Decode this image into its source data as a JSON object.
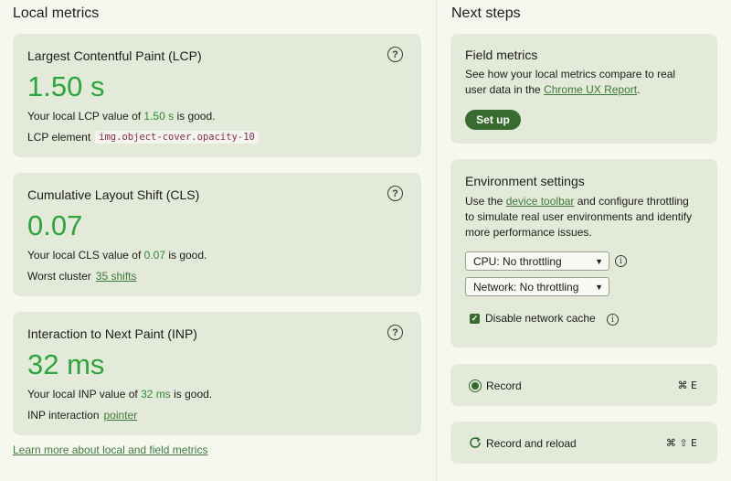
{
  "local_metrics": {
    "title": "Local metrics",
    "lcp": {
      "title": "Largest Contentful Paint (LCP)",
      "value": "1.50 s",
      "desc_prefix": "Your local LCP value of ",
      "desc_value": "1.50 s",
      "desc_suffix": " is good.",
      "detail_label": "LCP element",
      "detail_code": "img.object-cover.opacity-10"
    },
    "cls": {
      "title": "Cumulative Layout Shift (CLS)",
      "value": "0.07",
      "desc_prefix": "Your local CLS value of ",
      "desc_value": "0.07",
      "desc_suffix": " is good.",
      "detail_label": "Worst cluster",
      "detail_link": "35 shifts"
    },
    "inp": {
      "title": "Interaction to Next Paint (INP)",
      "value": "32 ms",
      "desc_prefix": "Your local INP value of ",
      "desc_value": "32 ms",
      "desc_suffix": " is good.",
      "detail_label": "INP interaction",
      "detail_link": "pointer"
    },
    "learn_more": "Learn more about local and field metrics"
  },
  "next_steps": {
    "title": "Next steps",
    "field_metrics": {
      "heading": "Field metrics",
      "text_1": "See how your local metrics compare to real",
      "text_2_prefix": "user data in the ",
      "text_2_link": "Chrome UX Report",
      "text_2_suffix": ".",
      "button": "Set up"
    },
    "environment": {
      "heading": "Environment settings",
      "text_1_prefix": "Use the ",
      "text_1_link": "device toolbar",
      "text_1_suffix": " and configure throttling",
      "text_2": "to simulate real user environments and identify",
      "text_3": "more performance issues.",
      "cpu_select": "CPU: No throttling",
      "network_select": "Network: No throttling",
      "checkbox_label": "Disable network cache",
      "checkbox_checked": true
    },
    "record": {
      "label": "Record",
      "shortcut": "⌘ E"
    },
    "record_reload": {
      "label": "Record and reload",
      "shortcut": "⌘ ⇧ E"
    }
  },
  "colors": {
    "good": "#2aa63a",
    "card_bg": "#e4ead9",
    "button_bg": "#386b2f",
    "link": "#3d7a3a"
  },
  "icons": [
    "help-icon",
    "info-icon",
    "checkbox-checked-icon",
    "record-icon",
    "reload-icon",
    "chevron-down-icon"
  ]
}
